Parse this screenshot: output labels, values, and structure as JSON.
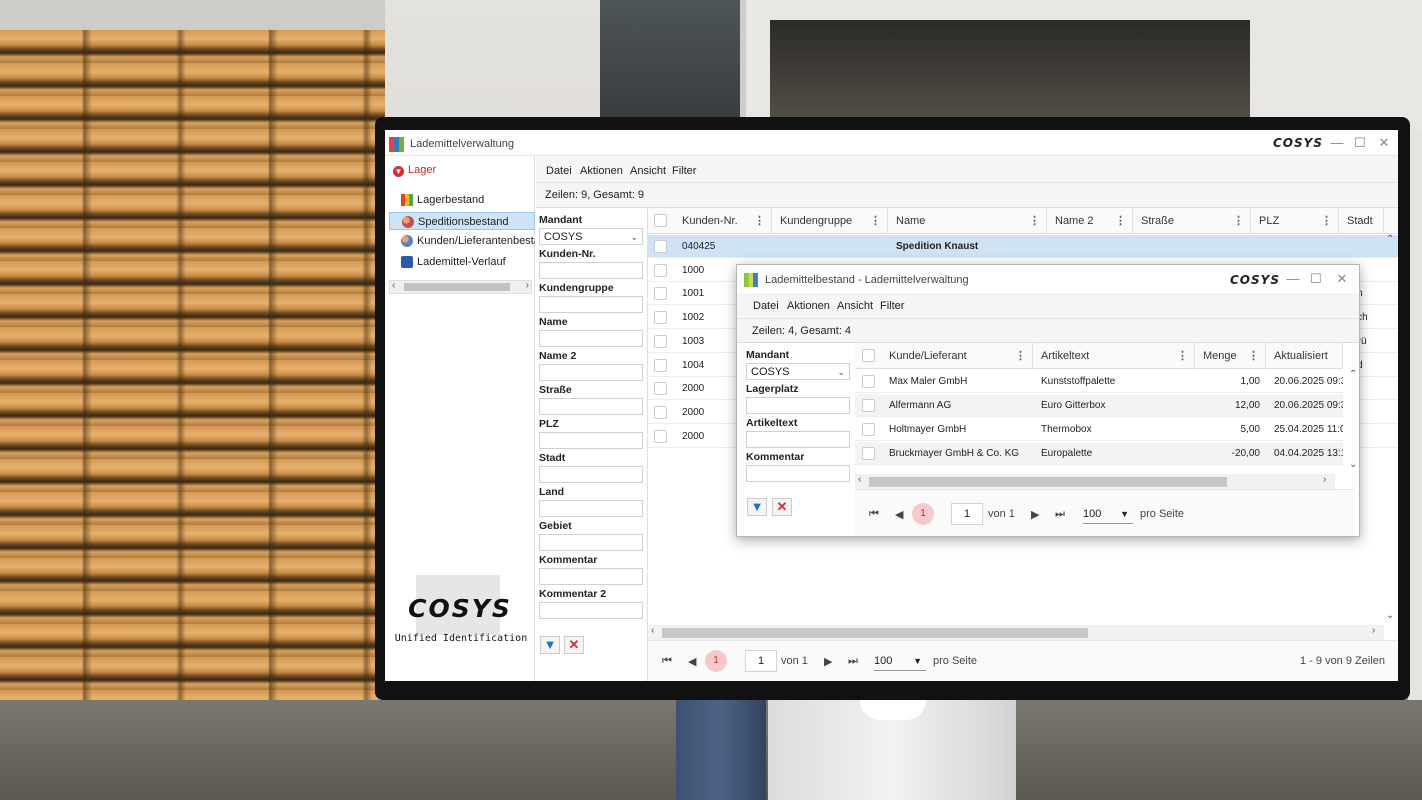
{
  "main_window": {
    "title": "Lademittelverwaltung",
    "logo": "COSYS",
    "sidebar": {
      "header": "Lager",
      "items": [
        {
          "label": "Lagerbestand"
        },
        {
          "label": "Speditionsbestand"
        },
        {
          "label": "Kunden/Lieferantenbestand"
        },
        {
          "label": "Lademittel-Verlauf"
        }
      ],
      "logo_word": "COSYS",
      "logo_sub": "Unified Identification"
    },
    "menu": [
      "Datei",
      "Aktionen",
      "Ansicht",
      "Filter"
    ],
    "rows_info": "Zeilen: 9, Gesamt: 9",
    "filter": {
      "mandant_label": "Mandant",
      "mandant_value": "COSYS",
      "fields": [
        "Kunden-Nr.",
        "Kundengruppe",
        "Name",
        "Name 2",
        "Straße",
        "PLZ",
        "Stadt",
        "Land",
        "Gebiet",
        "Kommentar",
        "Kommentar 2"
      ]
    },
    "grid": {
      "columns": [
        "Kunden-Nr.",
        "Kundengruppe",
        "Name",
        "Name 2",
        "Straße",
        "PLZ",
        "Stadt"
      ],
      "rows": [
        {
          "nr": "040425",
          "name": "Spedition Knaust",
          "stadt": ""
        },
        {
          "nr": "1000",
          "name": "",
          "stadt": "ne"
        },
        {
          "nr": "1001",
          "name": "",
          "stadt": "sden"
        },
        {
          "nr": "1002",
          "name": "",
          "stadt": "unsch"
        },
        {
          "nr": "1003",
          "name": "",
          "stadt": "nabrü"
        },
        {
          "nr": "1004",
          "name": "",
          "stadt": "mold"
        },
        {
          "nr": "2000",
          "name": "",
          "stadt": ""
        },
        {
          "nr": "2000",
          "name": "",
          "stadt": ""
        },
        {
          "nr": "2000",
          "name": "",
          "stadt": ""
        }
      ]
    },
    "pager": {
      "current": "1",
      "page_input": "1",
      "of_label": "von 1",
      "per_page": "100",
      "per_page_label": "pro Seite",
      "summary": "1 - 9 von 9 Zeilen"
    }
  },
  "overlay_window": {
    "title": "Lademittelbestand - Lademittelverwaltung",
    "logo": "COSYS",
    "menu": [
      "Datei",
      "Aktionen",
      "Ansicht",
      "Filter"
    ],
    "rows_info": "Zeilen: 4, Gesamt: 4",
    "filter": {
      "mandant_label": "Mandant",
      "mandant_value": "COSYS",
      "fields": [
        "Lagerplatz",
        "Artikeltext",
        "Kommentar"
      ]
    },
    "grid": {
      "columns": [
        "Kunde/Lieferant",
        "Artikeltext",
        "Menge",
        "Aktualisiert"
      ],
      "rows": [
        {
          "kunde": "Max Maler GmbH",
          "artikel": "Kunststoffpalette",
          "menge": "1,00",
          "aktualisiert": "20.06.2025 09:3"
        },
        {
          "kunde": "Alfermann AG",
          "artikel": "Euro Gitterbox",
          "menge": "12,00",
          "aktualisiert": "20.06.2025 09:3"
        },
        {
          "kunde": "Holtmayer GmbH",
          "artikel": "Thermobox",
          "menge": "5,00",
          "aktualisiert": "25.04.2025 11:0"
        },
        {
          "kunde": "Bruckmayer GmbH & Co. KG",
          "artikel": "Europalette",
          "menge": "-20,00",
          "aktualisiert": "04.04.2025 13:1"
        }
      ]
    },
    "pager": {
      "current": "1",
      "page_input": "1",
      "of_label": "von 1",
      "per_page": "100",
      "per_page_label": "pro Seite"
    }
  },
  "colors": {
    "accent_red": "#d32f2f",
    "selection": "#cfe2f6",
    "filter_blue": "#1e6fd0"
  }
}
